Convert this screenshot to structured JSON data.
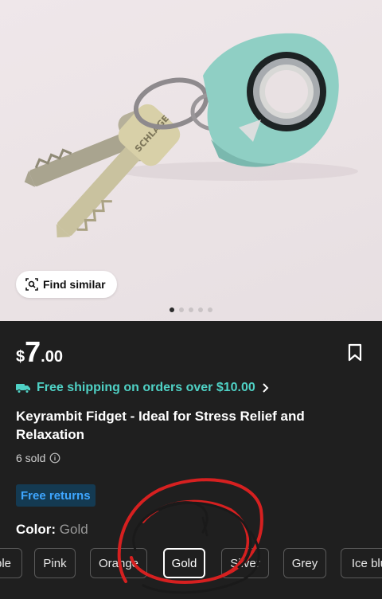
{
  "image_carousel": {
    "find_similar_label": "Find similar",
    "total_images": 5,
    "active_index": 0
  },
  "product": {
    "price_currency": "$",
    "price_whole": "7",
    "price_fraction": ".00",
    "shipping_text": "Free shipping on orders over $10.00",
    "title": "Keyrambit Fidget - Ideal for Stress Relief and Relaxation",
    "sold_text": "6 sold",
    "returns_badge": "Free returns",
    "color_label": "Color:",
    "color_value": "Gold"
  },
  "color_options": [
    "ple",
    "Pink",
    "Orange",
    "Gold",
    "Silver",
    "Grey",
    "Ice blu"
  ],
  "selected_color": "Gold",
  "photo_text": {
    "key_brand": "SCHLAGE"
  },
  "colors": {
    "shipping_green": "#4fd1c5",
    "returns_blue": "#3ea6ff",
    "returns_bg": "#143a52",
    "scribble_red": "#d62020"
  }
}
